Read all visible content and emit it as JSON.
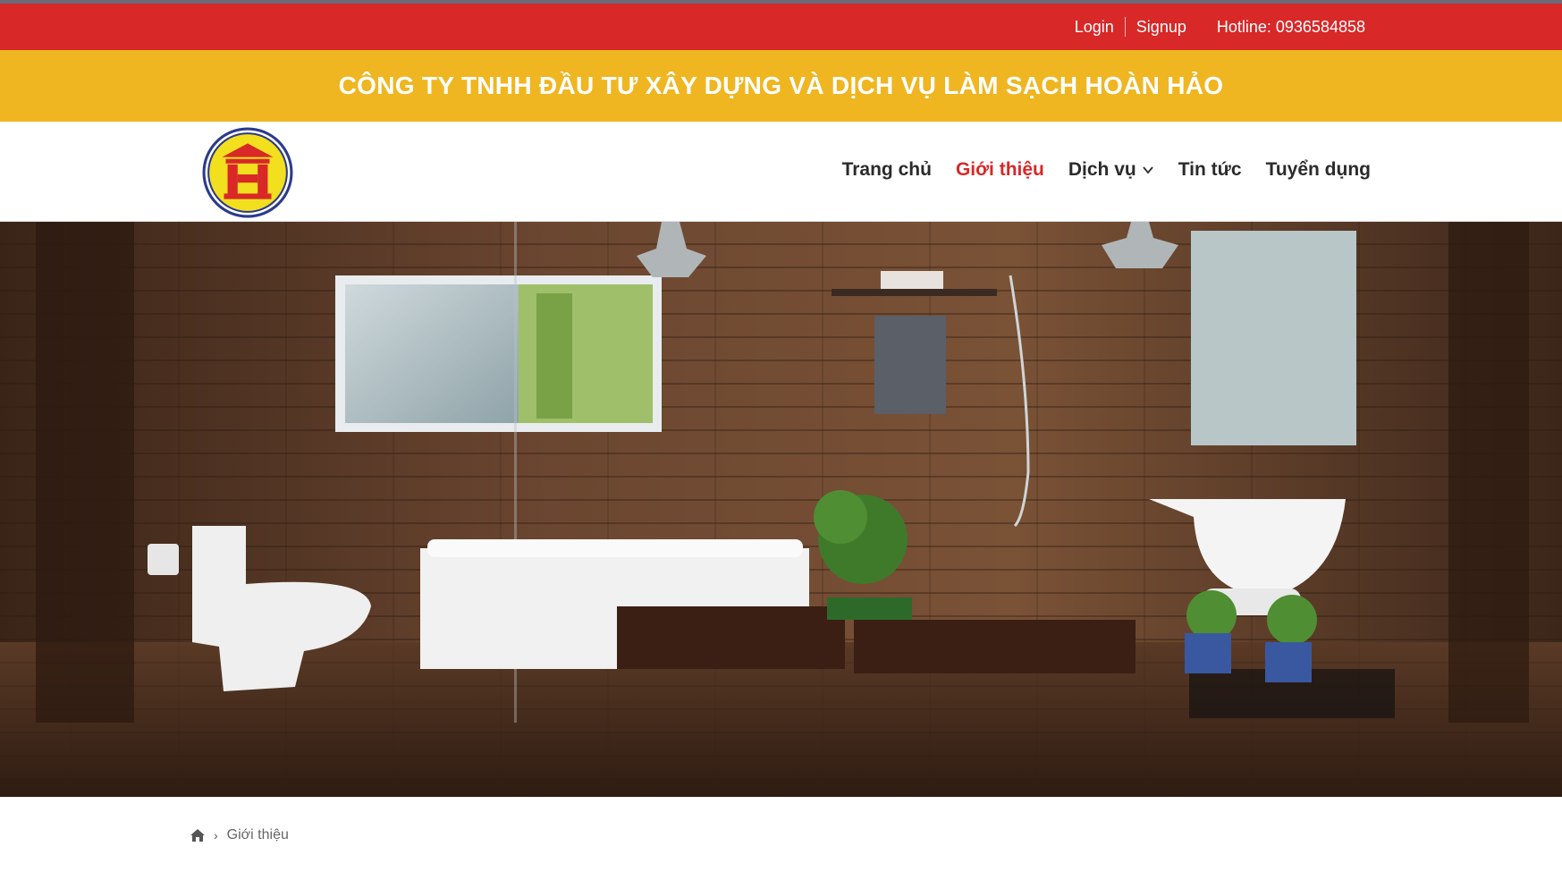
{
  "topbar": {
    "login": "Login",
    "signup": "Signup",
    "hotline": "Hotline: 0936584858"
  },
  "company": {
    "name": "CÔNG TY TNHH ĐẦU TƯ XÂY DỰNG VÀ DỊCH VỤ LÀM SẠCH HOÀN HẢO"
  },
  "nav": {
    "items": [
      {
        "label": "Trang chủ",
        "active": false
      },
      {
        "label": "Giới thiệu",
        "active": true
      },
      {
        "label": "Dịch vụ",
        "active": false,
        "dropdown": true
      },
      {
        "label": "Tin tức",
        "active": false
      },
      {
        "label": "Tuyển dụng",
        "active": false
      }
    ]
  },
  "breadcrumb": {
    "home_icon": "home-icon",
    "current": "Giới thiệu"
  },
  "colors": {
    "topbar": "#d82828",
    "companybar": "#efb621",
    "active_nav": "#d82828",
    "nav_text": "#2b2b2b"
  }
}
